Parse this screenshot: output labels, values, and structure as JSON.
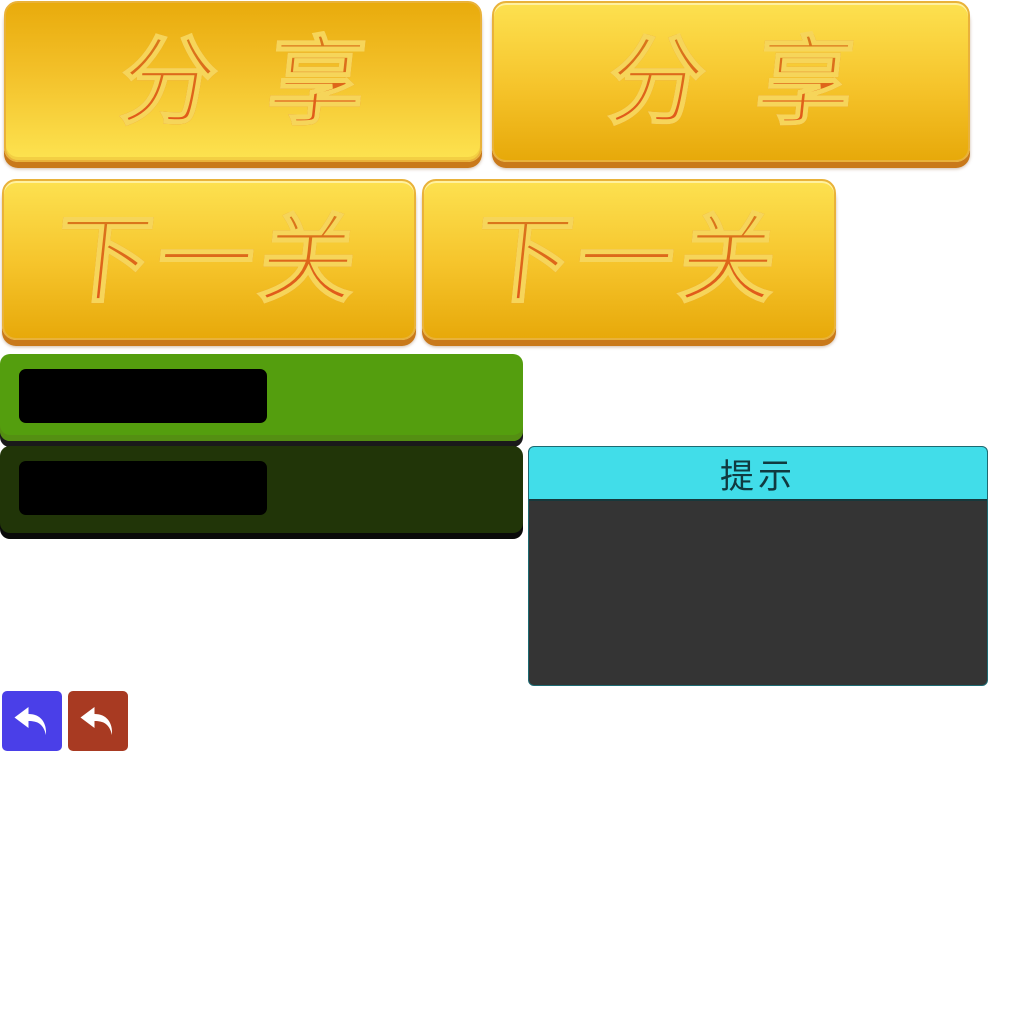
{
  "buttons": {
    "share_label": "分享",
    "next_level_label": "下一关"
  },
  "hint_dialog": {
    "title": "提示"
  },
  "back_buttons": {
    "icon": "undo-arrow-icon",
    "primary_color": "#4a3fe8",
    "secondary_color": "#a83a22"
  },
  "colors": {
    "button_yellow": "#f3c12a",
    "button_text": "#e25a18",
    "bar_green": "#549e0e",
    "bar_dark_green": "#213508",
    "dialog_header": "#41dde9",
    "dialog_body": "#343434"
  }
}
